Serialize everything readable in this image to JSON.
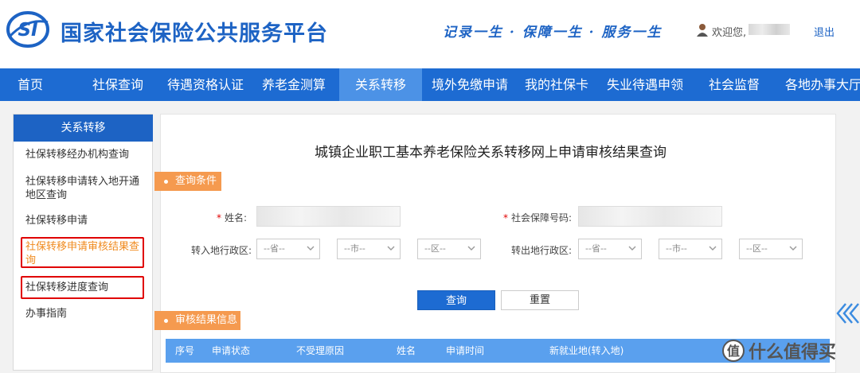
{
  "header": {
    "site_title": "国家社会保险公共服务平台",
    "logo_text": "SI",
    "slogan": "记录一生 · 保障一生 · 服务一生",
    "welcome": "欢迎您,",
    "logout": "退出"
  },
  "nav": {
    "items": [
      {
        "label": "首页"
      },
      {
        "label": "社保查询"
      },
      {
        "label": "待遇资格认证"
      },
      {
        "label": "养老金测算"
      },
      {
        "label": "关系转移",
        "active": true
      },
      {
        "label": "境外免缴申请"
      },
      {
        "label": "我的社保卡"
      },
      {
        "label": "失业待遇申领"
      },
      {
        "label": "社会监督"
      },
      {
        "label": "各地办事大厅"
      }
    ]
  },
  "sidebar": {
    "title": "关系转移",
    "items": [
      {
        "label": "社保转移经办机构查询"
      },
      {
        "label": "社保转移申请转入地开通地区查询"
      },
      {
        "label": "社保转移申请"
      },
      {
        "label": "社保转移申请审核结果查询",
        "selected": true
      },
      {
        "label": "社保转移进度查询"
      },
      {
        "label": "办事指南"
      }
    ]
  },
  "main": {
    "title": "城镇企业职工基本养老保险关系转移网上申请审核结果查询",
    "query_section": "查询条件",
    "result_section": "审核结果信息",
    "form": {
      "name_label": "姓名:",
      "ssn_label": "社会保障号码:",
      "required_mark": "*",
      "in_region_label": "转入地行政区:",
      "out_region_label": "转出地行政区:",
      "province_placeholder": "--省--",
      "city_placeholder": "--市--",
      "district_placeholder": "--区--"
    },
    "buttons": {
      "query": "查询",
      "reset": "重置"
    },
    "table_headers": [
      "序号",
      "申请状态",
      "不受理原因",
      "姓名",
      "申请时间",
      "新就业地(转入地)"
    ]
  },
  "watermark": {
    "text": "什么值得买"
  },
  "colors": {
    "brand_blue": "#1d63c4",
    "nav_blue": "#1d6bd2",
    "nav_active": "#4c92e6",
    "accent_orange": "#f59a4f",
    "highlight_red": "#e00000"
  }
}
